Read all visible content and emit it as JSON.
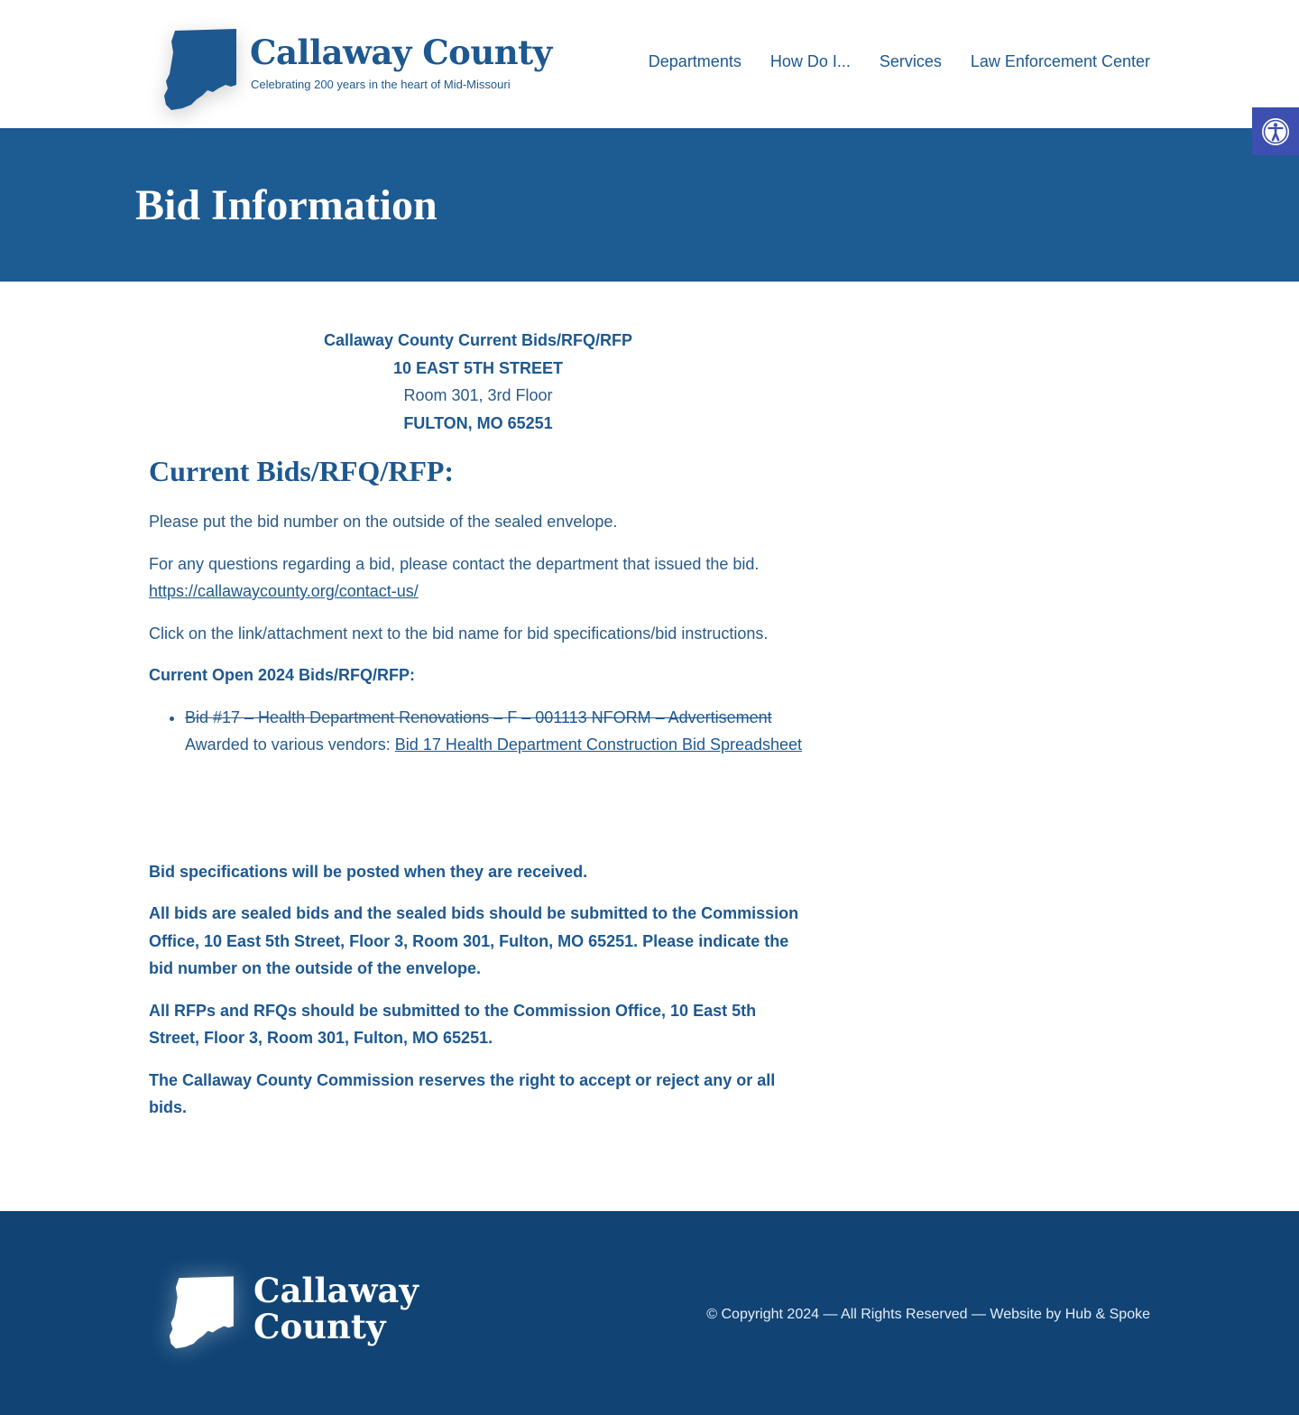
{
  "header": {
    "logo": {
      "title": "Callaway County",
      "tagline": "Celebrating 200 years in the heart of Mid-Missouri",
      "icon": "county-map-icon"
    },
    "nav": [
      {
        "label": "Departments"
      },
      {
        "label": "How Do I..."
      },
      {
        "label": "Services"
      },
      {
        "label": "Law Enforcement Center"
      }
    ],
    "accessibility_button": {
      "icon": "accessibility-icon",
      "label": "Accessibility tools"
    }
  },
  "hero": {
    "title": "Bid Information"
  },
  "content": {
    "address": {
      "line1": "Callaway County Current Bids/RFQ/RFP",
      "line2": "10 EAST 5TH STREET",
      "line3": "Room 301, 3rd Floor",
      "line4": "FULTON, MO 65251"
    },
    "section_title": "Current Bids/RFQ/RFP:",
    "para1": "Please put the bid number on the outside of the sealed envelope.",
    "para2_text": "For any questions regarding a bid, please contact the department that issued the bid. ",
    "para2_link": "https://callawaycounty.org/contact-us/",
    "para3": "Click on the link/attachment next to the bid name for bid specifications/bid instructions.",
    "open_bids_heading": "Current Open 2024 Bids/RFQ/RFP:",
    "bids": [
      {
        "struck_text": "Bid #17 – Health Department Renovations – ",
        "struck_link": "F – 001113 NFORM – Advertisement",
        "awarded_text": "Awarded to various vendors: ",
        "awarded_link": "Bid 17 Health Department Construction Bid Spreadsheet"
      }
    ],
    "notice1": "Bid specifications will be posted when they are received.",
    "notice2": "All bids are sealed bids and the sealed bids should be submitted to the Commission Office, 10 East 5th Street, Floor 3, Room 301, Fulton, MO 65251. Please indicate the bid number on the outside of the envelope.",
    "notice3": "All RFPs and RFQs should be submitted to the Commission Office, 10 East 5th Street, Floor 3, Room 301, Fulton, MO 65251.",
    "notice4": "The Callaway County Commission reserves the right to accept or reject any or all bids."
  },
  "footer": {
    "logo_line1": "Callaway",
    "logo_line2": "County",
    "copyright": "© Copyright 2024 — All Rights Reserved — Website by Hub & Spoke"
  },
  "colors": {
    "brand_blue": "#1d5891",
    "hero_blue": "#1d5b93",
    "footer_blue": "#114475",
    "accessibility_purple": "#3d4fb0"
  }
}
